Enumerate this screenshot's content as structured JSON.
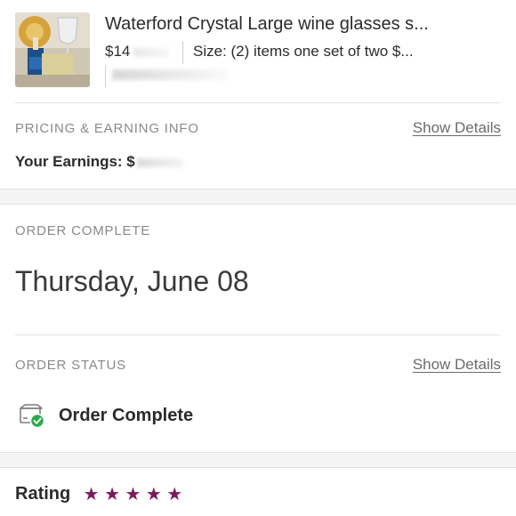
{
  "item": {
    "title": "Waterford Crystal Large wine glasses s...",
    "price": "$14",
    "size": "Size: (2) items one set of two $..."
  },
  "pricing": {
    "label": "PRICING & EARNING INFO",
    "show_details": "Show Details",
    "earnings_label": "Your Earnings: $"
  },
  "order": {
    "label": "ORDER COMPLETE",
    "date": "Thursday, June 08"
  },
  "status": {
    "label": "ORDER STATUS",
    "show_details": "Show Details",
    "text": "Order Complete",
    "icon": "box-check-icon"
  },
  "rating": {
    "label": "Rating",
    "stars": 5,
    "star_glyph": "★",
    "color": "#7a1a5c"
  },
  "colors": {
    "link": "#6b6b6b",
    "label": "#8a8a8a",
    "check": "#2eaa4f"
  }
}
